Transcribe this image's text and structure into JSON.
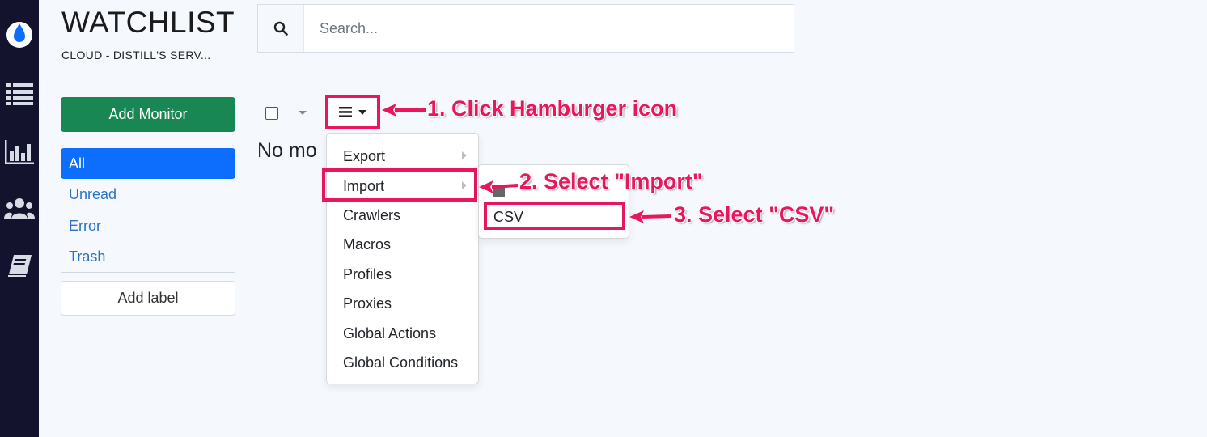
{
  "colors": {
    "rail": "#13132e",
    "accent_annotation": "#e8175d",
    "primary_blue": "#0d6efd",
    "add_green": "#198754",
    "link_blue": "#2a73c7"
  },
  "rail": {
    "icons": [
      "droplet-logo-icon",
      "list-icon",
      "bar-chart-icon",
      "users-icon",
      "book-icon"
    ]
  },
  "header": {
    "title": "WATCHLIST",
    "subtitle": "CLOUD - DISTILL'S SERV..."
  },
  "search": {
    "placeholder": "Search...",
    "value": ""
  },
  "sidebar": {
    "add_monitor": "Add Monitor",
    "items": [
      {
        "label": "All",
        "active": true
      },
      {
        "label": "Unread",
        "active": false
      },
      {
        "label": "Error",
        "active": false
      },
      {
        "label": "Trash",
        "active": false
      }
    ],
    "add_label": "Add label"
  },
  "main": {
    "empty_text": "No mo"
  },
  "menu": {
    "items": [
      {
        "label": "Export",
        "has_submenu": true
      },
      {
        "label": "Import",
        "has_submenu": true
      },
      {
        "label": "Crawlers",
        "has_submenu": false
      },
      {
        "label": "Macros",
        "has_submenu": false
      },
      {
        "label": "Profiles",
        "has_submenu": false
      },
      {
        "label": "Proxies",
        "has_submenu": false
      },
      {
        "label": "Global Actions",
        "has_submenu": false
      },
      {
        "label": "Global Conditions",
        "has_submenu": false
      }
    ],
    "submenu": {
      "items": [
        {
          "label": "CSV"
        }
      ]
    }
  },
  "annotations": {
    "step1": "1. Click Hamburger icon",
    "step2": "2. Select \"Import\"",
    "step3": "3. Select \"CSV\""
  }
}
